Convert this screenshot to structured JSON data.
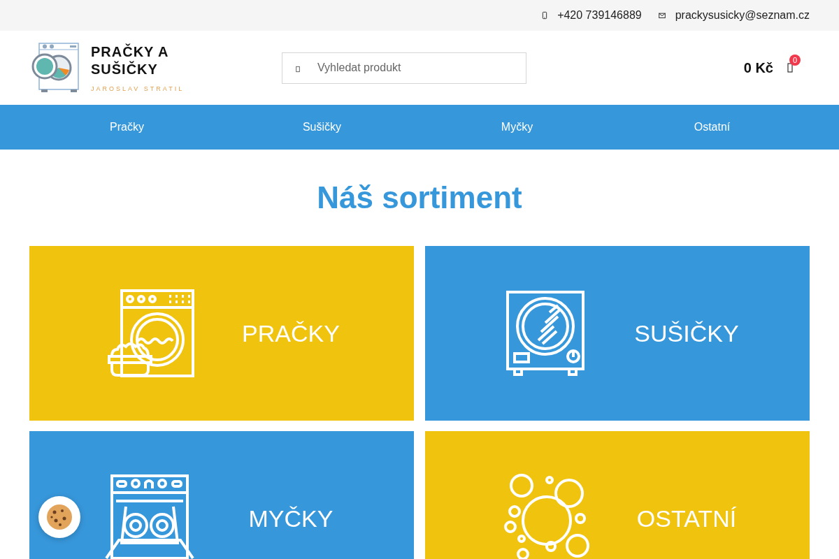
{
  "top_bar": {
    "phone": "+420 739146889",
    "email": "prackysusicky@seznam.cz"
  },
  "logo": {
    "title_line_1": "PRAČKY A",
    "title_line_2": "SUŠIČKY",
    "subtitle": "JAROSLAV STRATIL"
  },
  "search": {
    "placeholder": "Vyhledat produkt"
  },
  "cart": {
    "total": "0 Kč",
    "count": "0"
  },
  "nav": [
    {
      "label": "Pračky"
    },
    {
      "label": "Sušičky"
    },
    {
      "label": "Myčky"
    },
    {
      "label": "Ostatní"
    }
  ],
  "heading": "Náš sortiment",
  "categories": [
    {
      "label": "PRAČKY",
      "kind": "washer",
      "color": "#f0c30f"
    },
    {
      "label": "SUŠIČKY",
      "kind": "dryer",
      "color": "#3797db"
    },
    {
      "label": "MYČKY",
      "kind": "dishwasher",
      "color": "#3797db"
    },
    {
      "label": "OSTATNÍ",
      "kind": "bubbles",
      "color": "#f0c30f"
    }
  ]
}
